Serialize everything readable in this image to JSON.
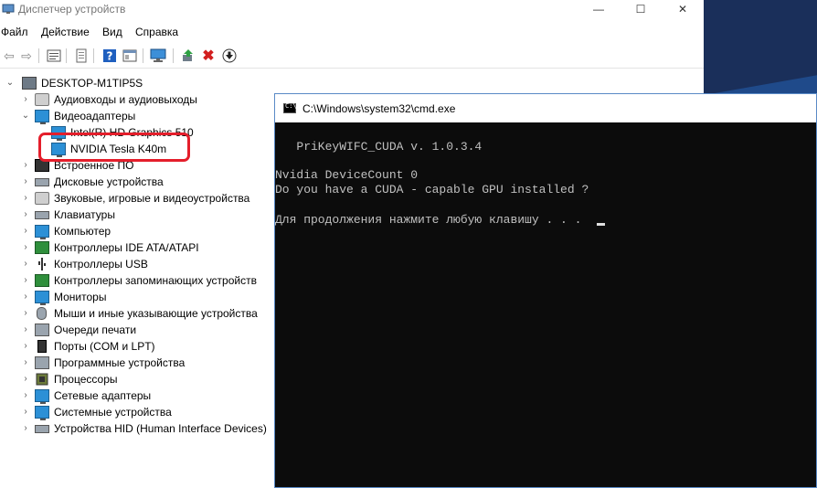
{
  "device_manager": {
    "title": "Диспетчер устройств",
    "menu": [
      "Файл",
      "Действие",
      "Вид",
      "Справка"
    ],
    "window_buttons": {
      "minimize": "—",
      "maximize": "☐",
      "close": "✕"
    },
    "tree": {
      "root": "DESKTOP-M1TIP5S",
      "items": [
        "Аудиовходы и аудиовыходы",
        "Видеоадаптеры",
        "Intel(R) HD Graphics 510",
        "NVIDIA Tesla K40m",
        "Встроенное ПО",
        "Дисковые устройства",
        "Звуковые, игровые и видеоустройства",
        "Клавиатуры",
        "Компьютер",
        "Контроллеры IDE ATA/ATAPI",
        "Контроллеры USB",
        "Контроллеры запоминающих устройств",
        "Мониторы",
        "Мыши и иные указывающие устройства",
        "Очереди печати",
        "Порты (COM и LPT)",
        "Программные устройства",
        "Процессоры",
        "Сетевые адаптеры",
        "Системные устройства",
        "Устройства HID (Human Interface Devices)"
      ]
    },
    "highlight_color": "#e41e2b"
  },
  "cmd": {
    "title": "C:\\Windows\\system32\\cmd.exe",
    "lines": [
      "   PriKeyWIFC_CUDA v. 1.0.3.4",
      "Nvidia DeviceCount 0",
      "Do you have a CUDA - capable GPU installed ?",
      "Для продолжения нажмите любую клавишу . . ."
    ]
  }
}
